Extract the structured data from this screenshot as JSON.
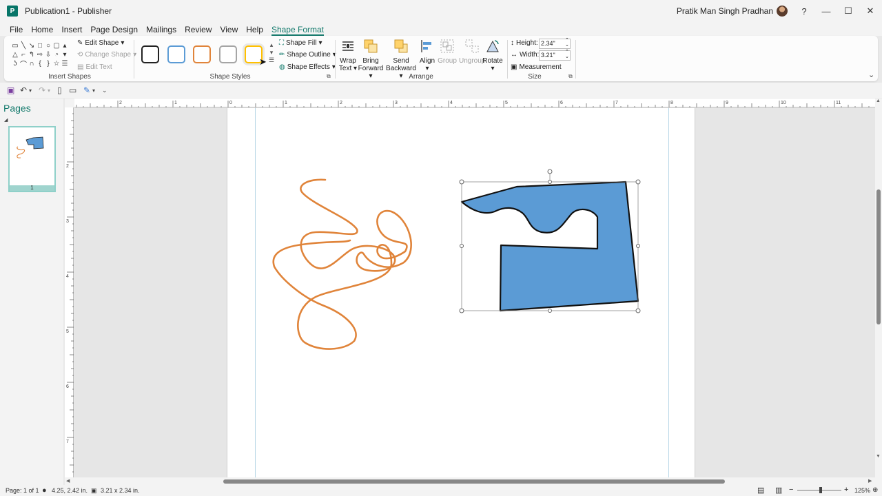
{
  "titlebar": {
    "doc_title": "Publication1  -  Publisher",
    "user": "Pratik Man Singh Pradhan",
    "help": "?",
    "minimize": "—",
    "maximize": "☐",
    "close": "✕"
  },
  "tabs": [
    "File",
    "Home",
    "Insert",
    "Page Design",
    "Mailings",
    "Review",
    "View",
    "Help",
    "Shape Format"
  ],
  "active_tab": "Shape Format",
  "ribbon": {
    "insert_shapes": {
      "label": "Insert Shapes",
      "edit_shape": "Edit Shape",
      "change_shape": "Change Shape",
      "edit_text": "Edit Text"
    },
    "shape_styles": {
      "label": "Shape Styles",
      "swatches": [
        "#222222",
        "#5b9bd5",
        "#e0843a",
        "#a5a5a5",
        "#ffc000"
      ],
      "shape_fill": "Shape Fill",
      "shape_outline": "Shape Outline",
      "shape_effects": "Shape Effects"
    },
    "arrange": {
      "label": "Arrange",
      "wrap_text": [
        "Wrap",
        "Text"
      ],
      "bring_forward": [
        "Bring",
        "Forward"
      ],
      "send_backward": [
        "Send",
        "Backward"
      ],
      "align": "Align",
      "group": "Group",
      "ungroup": "Ungroup",
      "rotate": "Rotate"
    },
    "size": {
      "label": "Size",
      "height_label": "Height:",
      "height_value": "2.34\"",
      "width_label": "Width:",
      "width_value": "3.21\"",
      "measurement": "Measurement"
    }
  },
  "pages_pane": {
    "title": "Pages",
    "page_number": "1"
  },
  "rulers": {
    "horizontal_labels": [
      "2",
      "1",
      "0",
      "1",
      "2",
      "3",
      "4",
      "5",
      "6",
      "7",
      "8",
      "9",
      "10",
      "11"
    ],
    "vertical_labels": [
      "2",
      "3",
      "4",
      "5",
      "6",
      "7"
    ]
  },
  "statusbar": {
    "page": "Page: 1 of 1",
    "position": "4.25, 2.42 in.",
    "size": "3.21 x 2.34 in.",
    "zoom": "125%"
  },
  "colors": {
    "accent": "#137a6c",
    "scribble": "#e0843a",
    "shape_fill": "#5b9bd5"
  }
}
